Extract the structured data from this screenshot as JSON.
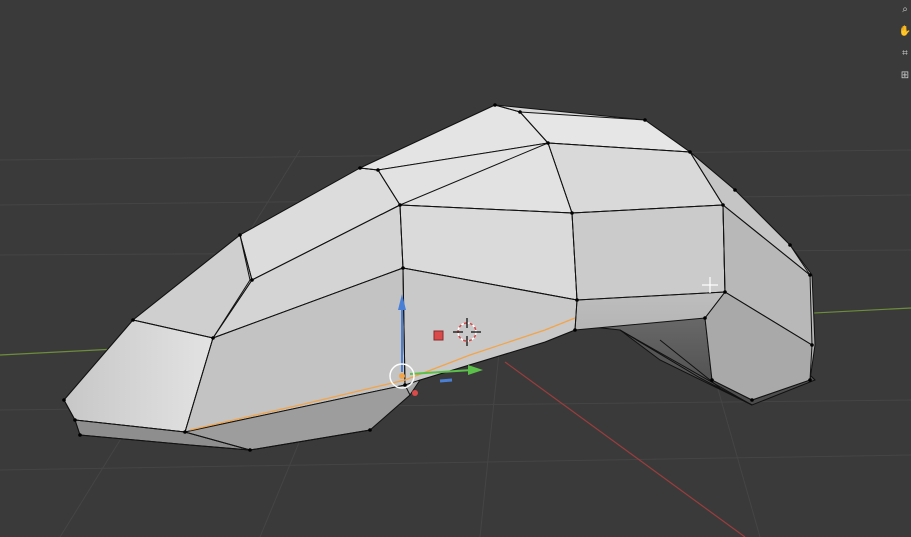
{
  "viewport": {
    "background_color": "#3a3a3a",
    "grid_color": "#444444",
    "x_axis_color": "#9b3d3d",
    "y_axis_color": "#6e8d3a",
    "mesh_color_light": "#e9e9e9",
    "mesh_color_mid": "#c8c8c8",
    "mesh_color_dark": "#6e6e6e",
    "edge_color": "#111111",
    "selected_edge_color": "#f2a44a"
  },
  "gizmo": {
    "z_arrow_color": "#4a7fd6",
    "y_arrow_color": "#5bc04a",
    "x_handle_color": "#d94a4a",
    "center_ring_color": "#ffffff",
    "origin_color": "#f2a44a"
  },
  "nav_icons": [
    {
      "name": "zoom-icon",
      "glyph": "⌕"
    },
    {
      "name": "pan-hand-icon",
      "glyph": "✋"
    },
    {
      "name": "camera-icon",
      "glyph": "⌗"
    },
    {
      "name": "ortho-grid-icon",
      "glyph": "⊞"
    }
  ]
}
